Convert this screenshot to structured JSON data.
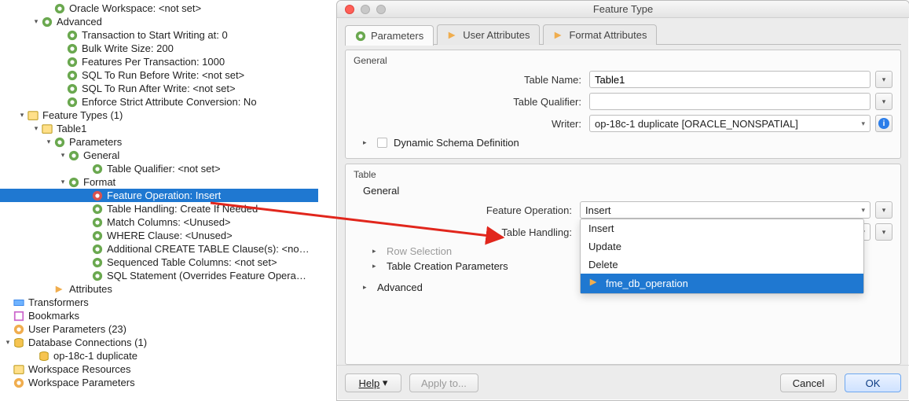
{
  "tree": {
    "oracle_workspace": "Oracle Workspace: <not set>",
    "advanced": "Advanced",
    "adv_items": [
      "Transaction to Start Writing at: 0",
      "Bulk Write Size: 200",
      "Features Per Transaction: 1000",
      "SQL To Run Before Write: <not set>",
      "SQL To Run After Write: <not set>",
      "Enforce Strict Attribute Conversion: No"
    ],
    "feature_types": "Feature Types (1)",
    "table1": "Table1",
    "parameters": "Parameters",
    "general": "General",
    "table_qualifier": "Table Qualifier: <not set>",
    "format": "Format",
    "format_items": {
      "feature_operation": "Feature Operation: Insert",
      "table_handling": "Table Handling: Create If Needed",
      "match_columns": "Match Columns: <Unused>",
      "where_clause": "WHERE Clause: <Unused>",
      "additional_create": "Additional CREATE TABLE Clause(s): <no…",
      "sequenced_cols": "Sequenced Table Columns: <not set>",
      "sql_statement": "SQL Statement (Overrides Feature Opera…"
    },
    "attributes": "Attributes",
    "transformers": "Transformers",
    "bookmarks": "Bookmarks",
    "user_parameters": "User Parameters (23)",
    "database_connections": "Database Connections (1)",
    "db_conn_item": "op-18c-1 duplicate",
    "workspace_resources": "Workspace Resources",
    "workspace_parameters_cut": "Workspace Parameters"
  },
  "dialog": {
    "title": "Feature Type",
    "tabs": {
      "parameters": "Parameters",
      "user_attributes": "User Attributes",
      "format_attributes": "Format Attributes"
    },
    "section_general": "General",
    "label_table_name": "Table Name:",
    "value_table_name": "Table1",
    "label_table_qualifier": "Table Qualifier:",
    "value_table_qualifier": "",
    "label_writer": "Writer:",
    "value_writer": "op-18c-1 duplicate [ORACLE_NONSPATIAL]",
    "dynamic_schema": "Dynamic Schema Definition",
    "section_table": "Table",
    "sub_general": "General",
    "label_feature_operation": "Feature Operation:",
    "value_feature_operation": "Insert",
    "feature_operation_options": [
      "Insert",
      "Update",
      "Delete",
      "fme_db_operation"
    ],
    "feature_operation_selected_option": "fme_db_operation",
    "label_table_handling": "Table Handling:",
    "value_table_handling": "",
    "row_selection": "Row Selection",
    "table_creation_params": "Table Creation Parameters",
    "advanced": "Advanced",
    "buttons": {
      "help": "Help",
      "apply_to": "Apply to...",
      "cancel": "Cancel",
      "ok": "OK"
    }
  }
}
